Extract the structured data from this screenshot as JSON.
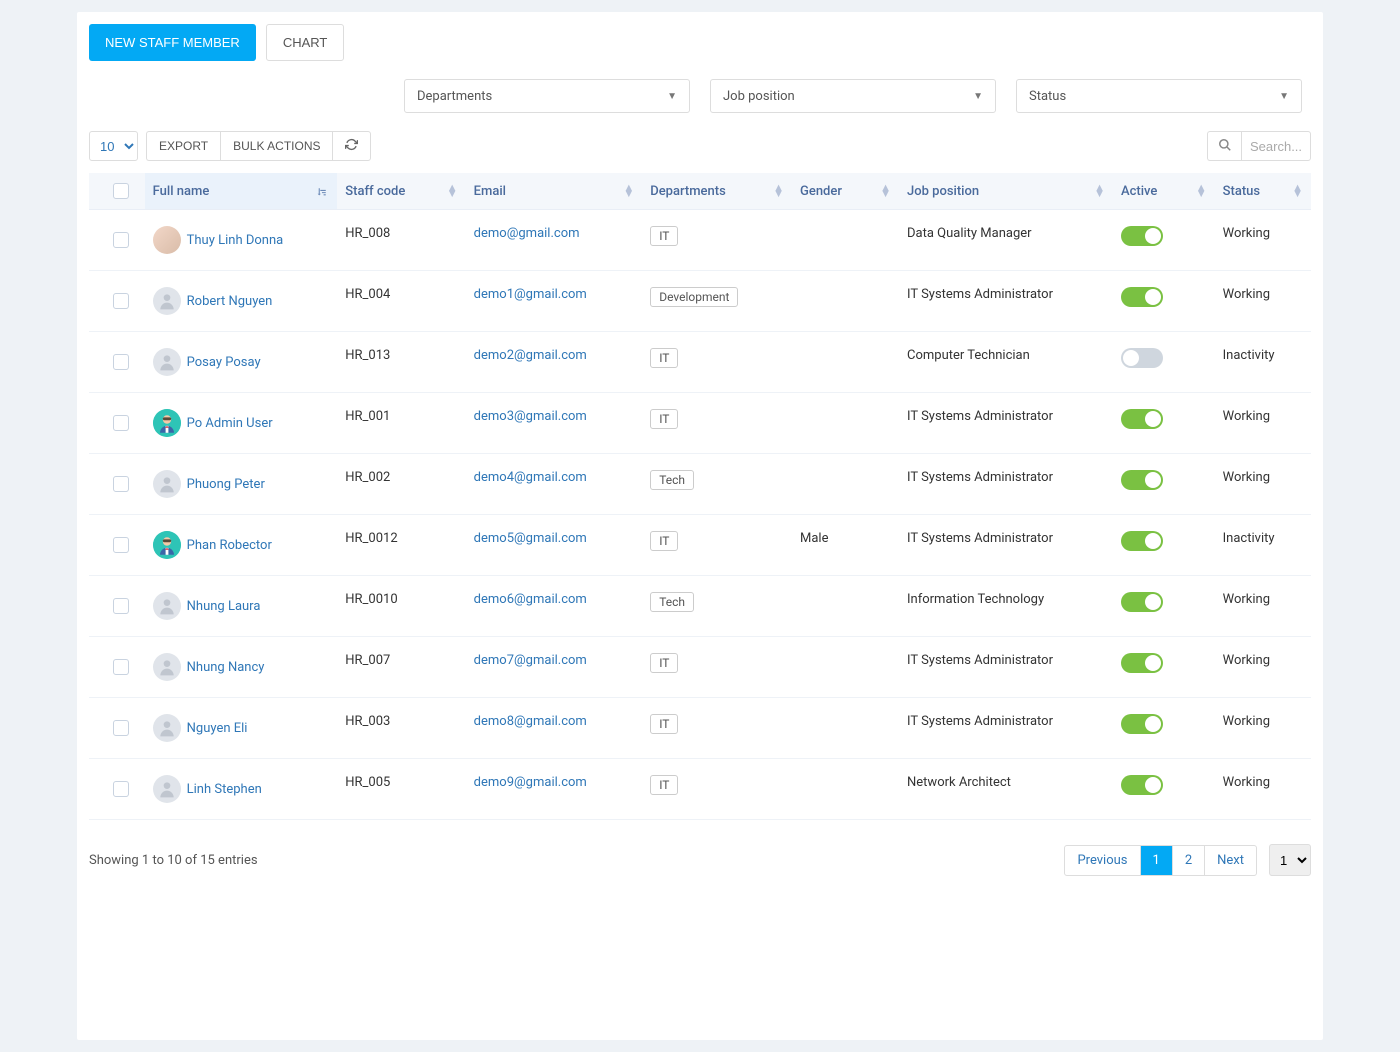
{
  "buttons": {
    "new_staff": "NEW STAFF MEMBER",
    "chart": "CHART",
    "export": "EXPORT",
    "bulk_actions": "BULK ACTIONS"
  },
  "filters": {
    "departments": "Departments",
    "job_position": "Job position",
    "status": "Status"
  },
  "page_size": "10",
  "search_placeholder": "Search...",
  "columns": {
    "full_name": "Full name",
    "staff_code": "Staff code",
    "email": "Email",
    "departments": "Departments",
    "gender": "Gender",
    "job_position": "Job position",
    "active": "Active",
    "status": "Status"
  },
  "rows": [
    {
      "name": "Thuy Linh Donna",
      "code": "HR_008",
      "email": "demo@gmail.com",
      "dept": "IT",
      "gender": "",
      "job": "Data Quality Manager",
      "active": true,
      "status": "Working",
      "avatar": "photo"
    },
    {
      "name": "Robert Nguyen",
      "code": "HR_004",
      "email": "demo1@gmail.com",
      "dept": "Development",
      "gender": "",
      "job": "IT Systems Administrator",
      "active": true,
      "status": "Working",
      "avatar": "blank"
    },
    {
      "name": "Posay Posay",
      "code": "HR_013",
      "email": "demo2@gmail.com",
      "dept": "IT",
      "gender": "",
      "job": "Computer Technician",
      "active": false,
      "status": "Inactivity",
      "avatar": "blank"
    },
    {
      "name": "Po Admin User",
      "code": "HR_001",
      "email": "demo3@gmail.com",
      "dept": "IT",
      "gender": "",
      "job": "IT Systems Administrator",
      "active": true,
      "status": "Working",
      "avatar": "illus"
    },
    {
      "name": "Phuong Peter",
      "code": "HR_002",
      "email": "demo4@gmail.com",
      "dept": "Tech",
      "gender": "",
      "job": "IT Systems Administrator",
      "active": true,
      "status": "Working",
      "avatar": "blank"
    },
    {
      "name": "Phan Robector",
      "code": "HR_0012",
      "email": "demo5@gmail.com",
      "dept": "IT",
      "gender": "Male",
      "job": "IT Systems Administrator",
      "active": true,
      "status": "Inactivity",
      "avatar": "illus"
    },
    {
      "name": "Nhung Laura",
      "code": "HR_0010",
      "email": "demo6@gmail.com",
      "dept": "Tech",
      "gender": "",
      "job": "Information Technology",
      "active": true,
      "status": "Working",
      "avatar": "blank"
    },
    {
      "name": "Nhung Nancy",
      "code": "HR_007",
      "email": "demo7@gmail.com",
      "dept": "IT",
      "gender": "",
      "job": "IT Systems Administrator",
      "active": true,
      "status": "Working",
      "avatar": "blank"
    },
    {
      "name": "Nguyen Eli",
      "code": "HR_003",
      "email": "demo8@gmail.com",
      "dept": "IT",
      "gender": "",
      "job": "IT Systems Administrator",
      "active": true,
      "status": "Working",
      "avatar": "blank"
    },
    {
      "name": "Linh Stephen",
      "code": "HR_005",
      "email": "demo9@gmail.com",
      "dept": "IT",
      "gender": "",
      "job": "Network Architect",
      "active": true,
      "status": "Working",
      "avatar": "blank"
    }
  ],
  "footer": {
    "info": "Showing 1 to 10 of 15 entries",
    "prev": "Previous",
    "next": "Next",
    "pages": [
      "1",
      "2"
    ],
    "current_page": "1",
    "page_select": "1"
  }
}
